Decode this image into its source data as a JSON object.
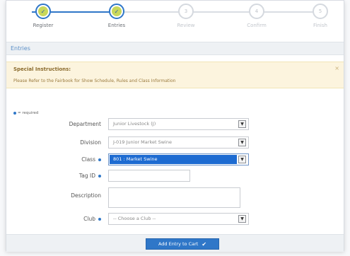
{
  "stepper": {
    "steps": [
      {
        "label": "Register",
        "status": "done",
        "number": ""
      },
      {
        "label": "Entries",
        "status": "done",
        "number": ""
      },
      {
        "label": "Review",
        "status": "pending",
        "number": "3"
      },
      {
        "label": "Confirm",
        "status": "pending",
        "number": "4"
      },
      {
        "label": "Finish",
        "status": "pending",
        "number": "5"
      }
    ]
  },
  "section": {
    "title": "Entries"
  },
  "instructions": {
    "title": "Special Instructions:",
    "body": "Please Refer to the Fairbook for Show Schedule, Rules and Class Information",
    "close": "×"
  },
  "form": {
    "required_note": "= required",
    "department": {
      "label": "Department",
      "value": "Junior Livestock (J)"
    },
    "division": {
      "label": "Division",
      "value": "J-019 Junior Market Swine"
    },
    "class": {
      "label": "Class",
      "value": "801 : Market Swine"
    },
    "tag_id": {
      "label": "Tag ID",
      "value": ""
    },
    "description": {
      "label": "Description",
      "value": ""
    },
    "club": {
      "label": "Club",
      "value": "-- Choose a Club --"
    }
  },
  "actions": {
    "add_to_cart": "Add Entry to Cart"
  },
  "colors": {
    "accent": "#2f77c8",
    "step_done_fill": "#c9d85b",
    "instructions_bg": "#fcf4de"
  },
  "icons": {
    "step_done": "check-icon",
    "select_arrow": "chevron-down-icon",
    "add_button": "check-icon",
    "close": "close-icon"
  }
}
